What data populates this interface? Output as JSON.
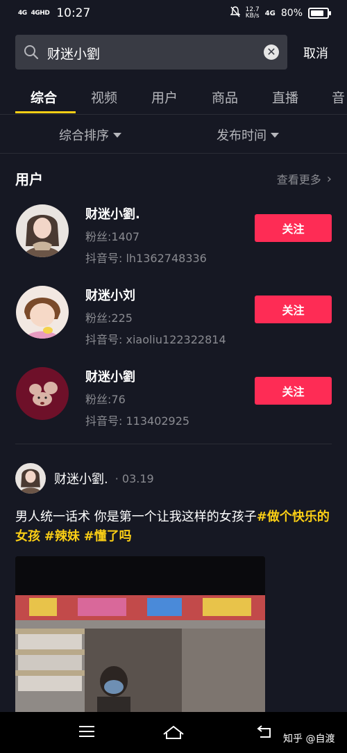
{
  "status_bar": {
    "signal1": "4G",
    "signal2": "4GHD",
    "time": "10:27",
    "net_speed_value": "12.7",
    "net_speed_unit": "KB/s",
    "net_type": "4G",
    "battery": "80%",
    "battery_level": 0.8
  },
  "search": {
    "query": "财迷小劉",
    "cancel_label": "取消"
  },
  "tabs": [
    "综合",
    "视频",
    "用户",
    "商品",
    "直播",
    "音"
  ],
  "filters": {
    "sort_label": "综合排序",
    "time_label": "发布时间"
  },
  "users_section": {
    "title": "用户",
    "see_more": "查看更多"
  },
  "users": [
    {
      "name": "财迷小劉.",
      "fans": "粉丝:1407",
      "douyin_id": "抖音号: lh1362748336",
      "follow_label": "关注"
    },
    {
      "name": "财迷小刘",
      "fans": "粉丝:225",
      "douyin_id": "抖音号: xiaoliu122322814",
      "follow_label": "关注"
    },
    {
      "name": "财迷小劉",
      "fans": "粉丝:76",
      "douyin_id": "抖音号: 113402925",
      "follow_label": "关注"
    }
  ],
  "post": {
    "author": "财迷小劉.",
    "date": "· 03.19",
    "caption_text": "男人统一话术 你是第一个让我这样的女孩子",
    "tags": [
      "#做个快乐的女孩",
      "#辣妹",
      "#懂了吗"
    ]
  },
  "watermark": "知乎 @自渡",
  "colors": {
    "background": "#161823",
    "accent": "#fe2c55",
    "tag": "#face15"
  }
}
